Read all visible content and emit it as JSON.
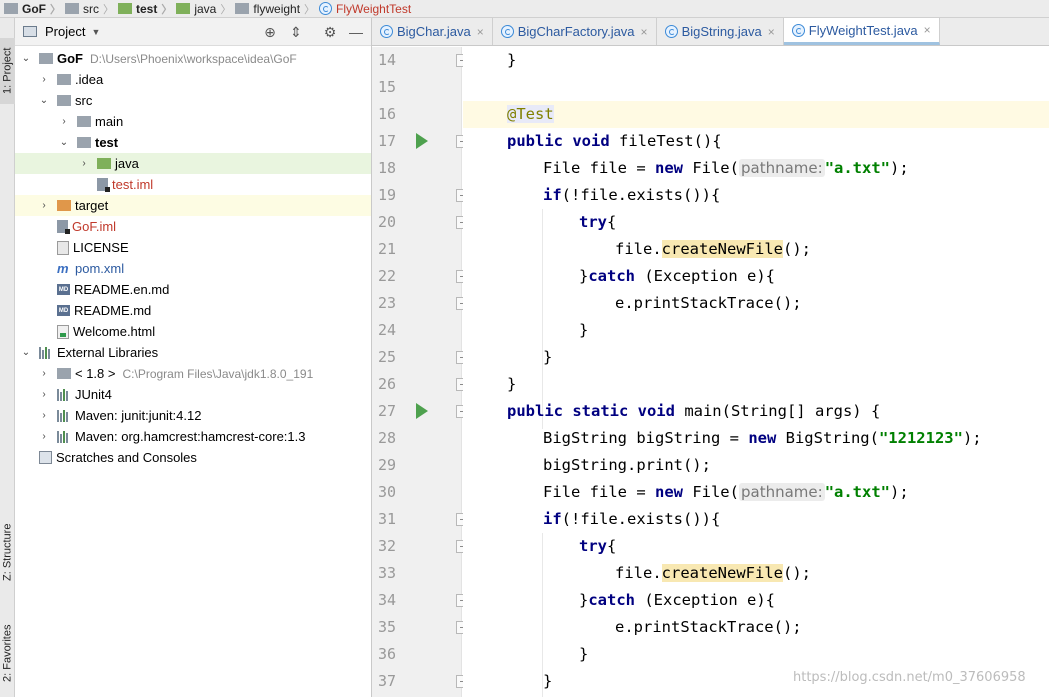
{
  "breadcrumb": [
    "GoF",
    "src",
    "test",
    "java",
    "flyweight",
    "FlyWeightTest"
  ],
  "tool_strip": {
    "project": "1: Project",
    "structure": "Z: Structure",
    "favorites": "2: Favorites"
  },
  "project_panel": {
    "title": "Project",
    "root_name": "GoF",
    "root_path": "D:\\Users\\Phoenix\\workspace\\idea\\GoF",
    "items": [
      {
        "label": ".idea"
      },
      {
        "label": "src"
      },
      {
        "label": "main"
      },
      {
        "label": "test"
      },
      {
        "label": "java"
      },
      {
        "label": "test.iml"
      },
      {
        "label": "target"
      },
      {
        "label": "GoF.iml"
      },
      {
        "label": "LICENSE"
      },
      {
        "label": "pom.xml"
      },
      {
        "label": "README.en.md"
      },
      {
        "label": "README.md"
      },
      {
        "label": "Welcome.html"
      },
      {
        "label": "External Libraries"
      },
      {
        "label": "< 1.8 >",
        "path": "C:\\Program Files\\Java\\jdk1.8.0_191"
      },
      {
        "label": "JUnit4"
      },
      {
        "label": "Maven: junit:junit:4.12"
      },
      {
        "label": "Maven: org.hamcrest:hamcrest-core:1.3"
      },
      {
        "label": "Scratches and Consoles"
      }
    ]
  },
  "tabs": [
    {
      "label": "BigChar.java"
    },
    {
      "label": "BigCharFactory.java"
    },
    {
      "label": "BigString.java"
    },
    {
      "label": "FlyWeightTest.java"
    }
  ],
  "line_numbers": [
    "14",
    "15",
    "16",
    "17",
    "18",
    "19",
    "20",
    "21",
    "22",
    "23",
    "24",
    "25",
    "26",
    "27",
    "28",
    "29",
    "30",
    "31",
    "32",
    "33",
    "34",
    "35",
    "36",
    "37"
  ],
  "code": {
    "l14": "}",
    "l16": "@Test",
    "l17_kw": "public void",
    "l17_rest": " fileTest(){",
    "l18_a": "File file = ",
    "l18_kw": "new",
    "l18_b": " File(",
    "l18_hint": "pathname:",
    "l18_str": "\"a.txt\"",
    "l18_end": ");",
    "l19_kw": "if",
    "l19_rest": "(!file.exists()){",
    "l20_kw": "try",
    "l20_rest": "{",
    "l21_a": "file.",
    "l21_m": "createNewFile",
    "l21_b": "();",
    "l22_a": "}",
    "l22_kw": "catch",
    "l22_b": " (Exception e){",
    "l23": "e.printStackTrace();",
    "l24": "}",
    "l25": "}",
    "l26": "}",
    "l27_kw": "public static void",
    "l27_rest": " main(String[] args) {",
    "l28_a": "BigString bigString = ",
    "l28_kw": "new",
    "l28_b": " BigString(",
    "l28_str": "\"1212123\"",
    "l28_end": ");",
    "l29": "bigString.print();",
    "l30_a": "File file = ",
    "l30_kw": "new",
    "l30_b": " File(",
    "l30_hint": "pathname:",
    "l30_str": "\"a.txt\"",
    "l30_end": ");",
    "l31_kw": "if",
    "l31_rest": "(!file.exists()){",
    "l32_kw": "try",
    "l32_rest": "{",
    "l33_a": "file.",
    "l33_m": "createNewFile",
    "l33_b": "();",
    "l34_a": "}",
    "l34_kw": "catch",
    "l34_b": " (Exception e){",
    "l35": "e.printStackTrace();",
    "l36": "}",
    "l37": "}"
  },
  "watermark": "https://blog.csdn.net/m0_37606958"
}
